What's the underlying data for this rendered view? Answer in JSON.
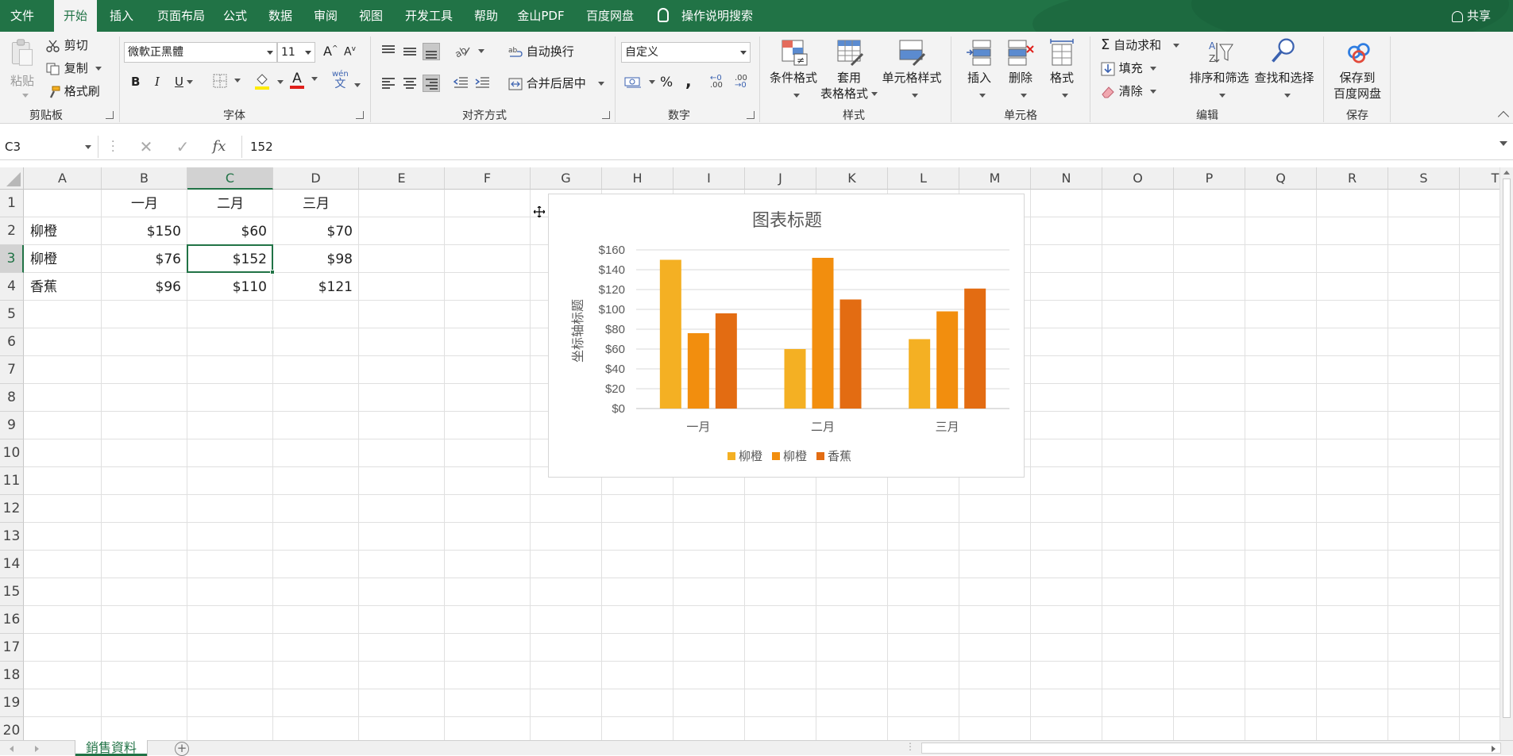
{
  "menu": {
    "tabs": [
      "文件",
      "开始",
      "插入",
      "页面布局",
      "公式",
      "数据",
      "审阅",
      "视图",
      "开发工具",
      "帮助",
      "金山PDF",
      "百度网盘"
    ],
    "active_tab": "开始",
    "tell_me": "操作说明搜索",
    "share": "共享"
  },
  "ribbon": {
    "clipboard": {
      "paste": "粘贴",
      "cut": "剪切",
      "copy": "复制",
      "format_painter": "格式刷",
      "label": "剪贴板"
    },
    "font": {
      "name": "微軟正黑體",
      "size": "11",
      "grow": "A",
      "shrink": "A",
      "bold": "B",
      "italic": "I",
      "underline": "U",
      "font_color": "A",
      "phonetic": "wén",
      "phonetic_char": "文",
      "label": "字体"
    },
    "alignment": {
      "wrap": "自动换行",
      "merge": "合并后居中",
      "label": "对齐方式"
    },
    "number": {
      "format": "自定义",
      "percent": "%",
      "comma": ",",
      "inc_decimal": ".00",
      "dec_decimal": ".00",
      "label": "数字"
    },
    "styles": {
      "conditional": "条件格式",
      "table_1": "套用",
      "table_2": "表格格式",
      "cell_styles": "单元格样式",
      "label": "样式"
    },
    "cells": {
      "insert": "插入",
      "delete": "删除",
      "format": "格式",
      "label": "单元格"
    },
    "editing": {
      "autosum": "自动求和",
      "fill": "填充",
      "clear": "清除",
      "sort": "排序和筛选",
      "find": "查找和选择",
      "label": "编辑"
    },
    "save": {
      "line1": "保存到",
      "line2": "百度网盘",
      "label": "保存"
    }
  },
  "formula_bar": {
    "name_box": "C3",
    "cancel": "✕",
    "enter": "✓",
    "fx": "fx",
    "value": "152"
  },
  "grid": {
    "columns": [
      "A",
      "B",
      "C",
      "D",
      "E",
      "F",
      "G",
      "H",
      "I",
      "J",
      "K",
      "L",
      "M",
      "N",
      "O",
      "P",
      "Q",
      "R",
      "S",
      "T"
    ],
    "selected_column": "C",
    "rows": [
      "1",
      "2",
      "3",
      "4",
      "5",
      "6",
      "7",
      "8",
      "9",
      "10",
      "11",
      "12",
      "13",
      "14",
      "15",
      "16",
      "17",
      "18",
      "19",
      "20"
    ],
    "selected_row": "3",
    "cells": {
      "B1": "一月",
      "C1": "二月",
      "D1": "三月",
      "A2": "柳橙",
      "B2": "$150",
      "C2": "$60",
      "D2": "$70",
      "A3": "柳橙",
      "B3": "$76",
      "C3": "$152",
      "D3": "$98",
      "A4": "香蕉",
      "B4": "$96",
      "C4": "$110",
      "D4": "$121"
    }
  },
  "chart_data": {
    "type": "bar",
    "title": "图表标题",
    "ylabel": "坐标轴标题",
    "xlabel": "",
    "categories": [
      "一月",
      "二月",
      "三月"
    ],
    "series": [
      {
        "name": "柳橙",
        "values": [
          150,
          60,
          70
        ],
        "color": "#f4b023"
      },
      {
        "name": "柳橙",
        "values": [
          76,
          152,
          98
        ],
        "color": "#f28e0e"
      },
      {
        "name": "香蕉",
        "values": [
          96,
          110,
          121
        ],
        "color": "#e36c12"
      }
    ],
    "ylim": [
      0,
      160
    ],
    "yticks": [
      "$0",
      "$20",
      "$40",
      "$60",
      "$80",
      "$100",
      "$120",
      "$140",
      "$160"
    ],
    "grid": true,
    "legend": "bottom"
  },
  "sheet_tabs": {
    "active": "銷售資料",
    "add": "+"
  },
  "colors": {
    "accent": "#217346"
  }
}
